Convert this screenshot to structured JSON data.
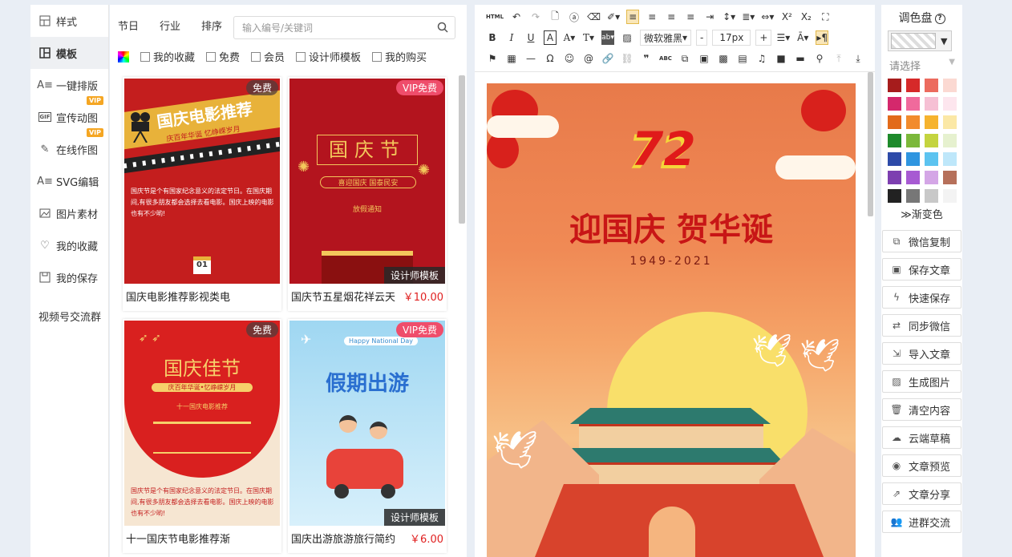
{
  "nav": {
    "items": [
      {
        "label": "样式",
        "icon": "layout-icon"
      },
      {
        "label": "模板",
        "icon": "template-icon",
        "active": true
      },
      {
        "label": "一键排版",
        "icon": "format-icon",
        "vip": "VIP"
      },
      {
        "label": "宣传动图",
        "icon": "gif-icon",
        "vip": "VIP"
      },
      {
        "label": "在线作图",
        "icon": "draw-icon"
      },
      {
        "label": "SVG编辑",
        "icon": "svg-icon"
      },
      {
        "label": "图片素材",
        "icon": "image-icon"
      },
      {
        "label": "我的收藏",
        "icon": "heart-icon"
      },
      {
        "label": "我的保存",
        "icon": "save-icon"
      }
    ],
    "extra": "视频号交流群"
  },
  "templates": {
    "tabs": [
      "节日",
      "行业",
      "排序"
    ],
    "search_placeholder": "输入编号/关键词",
    "filters": [
      "我的收藏",
      "免费",
      "会员",
      "设计师模板",
      "我的购买"
    ],
    "cards": [
      {
        "title": "国庆电影推荐影视类电",
        "badge": "免费",
        "price": "",
        "designer": "",
        "poster": {
          "heading": "国庆电影推荐",
          "sub": "庆百年华诞 忆峥嵘岁月",
          "body": "国庆节是个有国家纪念意义的法定节日。在国庆期间,有很多朋友都会选择去看电影。国庆上映的电影也有不少哟!",
          "date": "01"
        }
      },
      {
        "title": "国庆节五星烟花祥云天",
        "badge": "VIP免费",
        "price": "￥10.00",
        "designer": "设计师模板",
        "poster": {
          "heading": "国庆节",
          "sub": "喜迎国庆 国泰民安",
          "body": "放假通知"
        }
      },
      {
        "title": "十一国庆节电影推荐渐",
        "badge": "免费",
        "price": "",
        "designer": "",
        "poster": {
          "heading": "国庆佳节",
          "sub": "庆百年华诞•忆峥嵘岁月",
          "sub2": "十一国庆电影推荐",
          "body": "国庆节是个有国家纪念意义的法定节日。在国庆期间,有很多朋友都会选择去看电影。国庆上映的电影也有不少哟!"
        }
      },
      {
        "title": "国庆出游旅游旅行简约",
        "badge": "VIP免费",
        "price": "￥6.00",
        "designer": "设计师模板",
        "poster": {
          "heading": "假期出游",
          "sub": "Happy National Day"
        }
      }
    ]
  },
  "toolbar": {
    "font": "微软雅黑",
    "size": "17px",
    "minus": "-",
    "plus": "+"
  },
  "canvas": {
    "number": "72",
    "headline": "迎国庆 贺华诞",
    "years": "1949-2021"
  },
  "palette": {
    "title": "调色盘",
    "help": "?",
    "select": "请选择",
    "gradient": "≫渐变色",
    "colors": [
      "#a61c1c",
      "#d62929",
      "#ec6b5e",
      "#fbd9d2",
      "#d4286c",
      "#f06a9c",
      "#f6c0d4",
      "#fde6ee",
      "#e26a1a",
      "#f28b2c",
      "#f6b32e",
      "#fbe8a6",
      "#1d8a2b",
      "#7bb83a",
      "#c4d43f",
      "#e6f1cf",
      "#2d4aa8",
      "#2f95e0",
      "#5cc3f0",
      "#bee7fa",
      "#7d3fb0",
      "#a75ad2",
      "#d4a6e6",
      "#b6705a",
      "#222222",
      "#777777",
      "#c8c8c8",
      "#f3f3f3"
    ],
    "buttons": [
      {
        "label": "微信复制",
        "icon": "copy-icon"
      },
      {
        "label": "保存文章",
        "icon": "save-icon"
      },
      {
        "label": "快速保存",
        "icon": "flash-icon"
      },
      {
        "label": "同步微信",
        "icon": "sync-icon"
      },
      {
        "label": "导入文章",
        "icon": "import-icon"
      },
      {
        "label": "生成图片",
        "icon": "image-icon"
      },
      {
        "label": "清空内容",
        "icon": "trash-icon"
      },
      {
        "label": "云端草稿",
        "icon": "cloud-icon"
      },
      {
        "label": "文章预览",
        "icon": "eye-icon"
      },
      {
        "label": "文章分享",
        "icon": "share-icon"
      },
      {
        "label": "进群交流",
        "icon": "group-icon"
      }
    ]
  }
}
